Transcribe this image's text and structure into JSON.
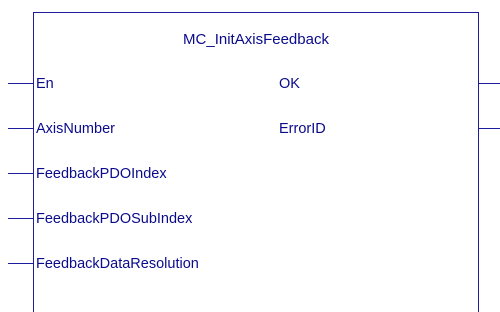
{
  "block": {
    "title": "MC_InitAxisFeedback"
  },
  "inputs": [
    {
      "label": "En"
    },
    {
      "label": "AxisNumber"
    },
    {
      "label": "FeedbackPDOIndex"
    },
    {
      "label": "FeedbackPDOSubIndex"
    },
    {
      "label": "FeedbackDataResolution"
    }
  ],
  "outputs": [
    {
      "label": "OK"
    },
    {
      "label": "ErrorID"
    }
  ]
}
